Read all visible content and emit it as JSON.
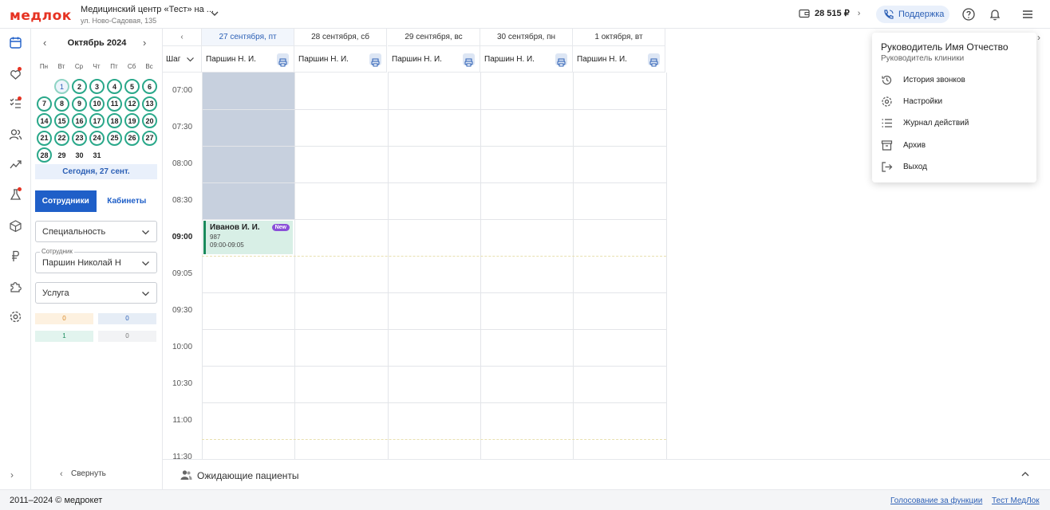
{
  "header": {
    "logo": "медлок",
    "clinic_name": "Медицинский центр «Тест» на ...",
    "clinic_address": "ул. Ново-Садовая, 135",
    "balance": "28 515 ₽",
    "support_label": "Поддержка"
  },
  "calendar_widget": {
    "month_title": "Октябрь 2024",
    "weekdays": [
      "Пн",
      "Вт",
      "Ср",
      "Чт",
      "Пт",
      "Сб",
      "Вс"
    ],
    "days": [
      "1",
      "2",
      "3",
      "4",
      "5",
      "6",
      "7",
      "8",
      "9",
      "10",
      "11",
      "12",
      "13",
      "14",
      "15",
      "16",
      "17",
      "18",
      "19",
      "20",
      "21",
      "22",
      "23",
      "24",
      "25",
      "26",
      "27",
      "28",
      "29",
      "30",
      "31"
    ],
    "today_button": "Сегодня, 27 сент."
  },
  "filters": {
    "tab_staff": "Сотрудники",
    "tab_rooms": "Кабинеты",
    "specialty": "Специальность",
    "employee_label": "Сотрудник",
    "employee_value": "Паршин Николай Н",
    "service": "Услуга",
    "counters": [
      "0",
      "0",
      "1",
      "0"
    ],
    "collapse": "Свернуть"
  },
  "schedule": {
    "columns": [
      {
        "date": "27 сентября, пт",
        "staff": "Паршин Н. И."
      },
      {
        "date": "28 сентября, сб",
        "staff": "Паршин Н. И."
      },
      {
        "date": "29 сентября, вс",
        "staff": "Паршин Н. И."
      },
      {
        "date": "30 сентября, пн",
        "staff": "Паршин Н. И."
      },
      {
        "date": "1 октября, вт",
        "staff": "Паршин Н. И."
      }
    ],
    "step_label": "Шаг",
    "times": [
      "07:00",
      "07:30",
      "08:00",
      "08:30",
      "09:00",
      "09:05",
      "09:30",
      "10:00",
      "10:30",
      "11:00",
      "11:30"
    ],
    "appointment": {
      "patient": "Иванов И. И.",
      "badge": "New",
      "number": "987",
      "time": "09:00-09:05"
    }
  },
  "waiting": {
    "label": "Ожидающие пациенты"
  },
  "footer": {
    "copyright": "2011–2024 © медрокет",
    "link_vote": "Голосование за функции",
    "link_test": "Тест МедЛок"
  },
  "user_menu": {
    "user_name": "Руководитель Имя Отчество",
    "user_role": "Руководитель клиники",
    "items": [
      "История звонков",
      "Настройки",
      "Журнал действий",
      "Архив",
      "Выход"
    ]
  },
  "colors": {
    "accent": "#1f5fc8",
    "brand": "#e63323",
    "calendar_day_ring": "#2aa88a",
    "appointment_bar": "#1a8a5c",
    "blocked_slot": "#c7d0de"
  }
}
